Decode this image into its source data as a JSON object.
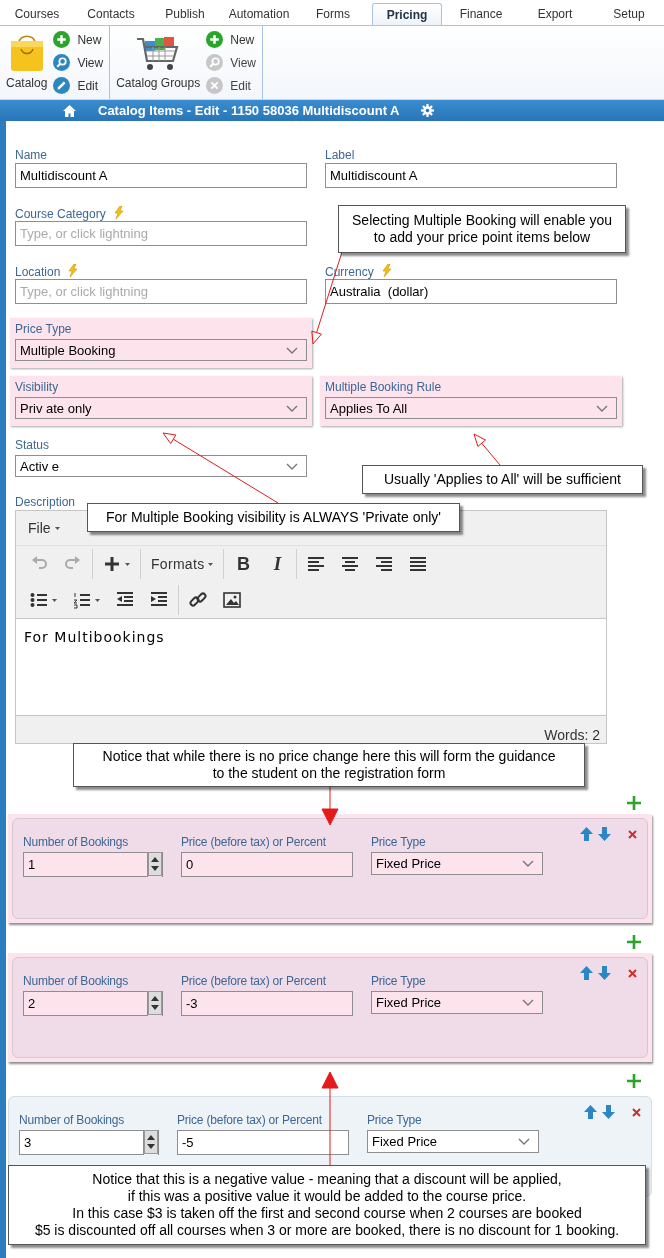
{
  "tabs": [
    {
      "label": "Courses",
      "selected": false
    },
    {
      "label": "Contacts",
      "selected": false
    },
    {
      "label": "Publish",
      "selected": false
    },
    {
      "label": "Automation",
      "selected": false
    },
    {
      "label": "Forms",
      "selected": false
    },
    {
      "label": "Pricing",
      "selected": true
    },
    {
      "label": "Finance",
      "selected": false
    },
    {
      "label": "Export",
      "selected": false
    },
    {
      "label": "Setup",
      "selected": false
    }
  ],
  "ribbon": {
    "groups": [
      {
        "kind": "bag",
        "label": "Catalog",
        "actions": [
          {
            "kind": "new",
            "label": "New",
            "disabled": false
          },
          {
            "kind": "view",
            "label": "View",
            "disabled": false
          },
          {
            "kind": "edit",
            "label": "Edit",
            "disabled": false
          }
        ]
      },
      {
        "kind": "cart",
        "label": "Catalog Groups",
        "actions": [
          {
            "kind": "new",
            "label": "New",
            "disabled": false
          },
          {
            "kind": "view",
            "label": "View",
            "disabled": true
          },
          {
            "kind": "edit",
            "label": "Edit",
            "disabled": true
          }
        ]
      }
    ]
  },
  "title_bar": {
    "title": "Catalog Items - Edit - 1150 58036 Multidiscount A"
  },
  "form": {
    "rows": [
      {
        "fields": [
          {
            "kind": "text",
            "label": "Name",
            "value": "Multidiscount A",
            "lightning": false,
            "highlighted": false
          },
          {
            "kind": "text",
            "label": "Label",
            "value": "Multidiscount A",
            "lightning": false,
            "highlighted": false
          }
        ]
      },
      {
        "fields": [
          {
            "kind": "text",
            "label": "Course Category",
            "placeholder": "Type, or click lightning",
            "lightning": true,
            "highlighted": false
          }
        ]
      },
      {
        "fields": [
          {
            "kind": "text",
            "label": "Location",
            "placeholder": "Type, or click lightning",
            "lightning": true,
            "highlighted": false
          },
          {
            "kind": "text",
            "label": "Currency",
            "value": "Australia  (dollar)",
            "lightning": true,
            "highlighted": false
          }
        ]
      },
      {
        "fields": [
          {
            "kind": "select",
            "label": "Price Type",
            "value": "Multiple Booking",
            "lightning": false,
            "highlighted": true
          }
        ]
      },
      {
        "fields": [
          {
            "kind": "select",
            "label": "Visibility",
            "value": "Priv ate only",
            "lightning": false,
            "highlighted": true
          },
          {
            "kind": "select",
            "label": "Multiple Booking Rule",
            "value": "Applies To All",
            "lightning": false,
            "highlighted": true
          }
        ]
      },
      {
        "fields": [
          {
            "kind": "select",
            "label": "Status",
            "value": "Activ e",
            "lightning": false,
            "highlighted": false
          }
        ]
      }
    ]
  },
  "description": {
    "label": "Description",
    "menu": [
      "File"
    ],
    "toolbar": [
      [
        [
          {
            "kind": "undo",
            "disabled": true
          },
          {
            "kind": "redo",
            "disabled": true
          }
        ],
        [
          {
            "kind": "insert",
            "has_menu": true
          }
        ],
        [
          {
            "kind": "formats",
            "label": "Formats",
            "has_menu": true
          }
        ],
        [
          {
            "kind": "bold",
            "label": "B"
          },
          {
            "kind": "italic",
            "label": "I"
          }
        ],
        [
          {
            "kind": "align-left"
          },
          {
            "kind": "align-center"
          },
          {
            "kind": "align-right"
          },
          {
            "kind": "justify"
          }
        ]
      ],
      [
        [
          {
            "kind": "bullet-list",
            "has_menu": true
          },
          {
            "kind": "numbered-list",
            "has_menu": true
          },
          {
            "kind": "outdent"
          },
          {
            "kind": "indent"
          }
        ],
        [
          {
            "kind": "link"
          },
          {
            "kind": "image"
          }
        ]
      ]
    ],
    "content": "For Multibookings",
    "word_count": "Words: 2"
  },
  "price_points": [
    {
      "highlighted": true,
      "fields": [
        {
          "kind": "spinner",
          "label": "Number of Bookings",
          "value": "1"
        },
        {
          "kind": "text",
          "label": "Price (before tax) or Percent",
          "value": "0"
        },
        {
          "kind": "select",
          "label": "Price Type",
          "value": "Fixed Price"
        }
      ]
    },
    {
      "highlighted": true,
      "fields": [
        {
          "kind": "spinner",
          "label": "Number of Bookings",
          "value": "2"
        },
        {
          "kind": "text",
          "label": "Price (before tax) or Percent",
          "value": "-3"
        },
        {
          "kind": "select",
          "label": "Price Type",
          "value": "Fixed Price"
        }
      ]
    },
    {
      "highlighted": false,
      "fields": [
        {
          "kind": "spinner",
          "label": "Number of Bookings",
          "value": "3"
        },
        {
          "kind": "text",
          "label": "Price (before tax) or Percent",
          "value": "-5"
        },
        {
          "kind": "select",
          "label": "Price Type",
          "value": "Fixed Price"
        }
      ]
    }
  ],
  "callouts": [
    {
      "lines": [
        "Selecting Multiple Booking will enable you",
        "to add your price point items below"
      ]
    },
    {
      "lines": [
        "Usually 'Applies to All' will be sufficient"
      ]
    },
    {
      "lines": [
        "For Multiple Booking visibility is ALWAYS 'Private only'"
      ]
    },
    {
      "lines": [
        "Notice that while there is no price change here this will form the guidance",
        "to the student on the registration form"
      ]
    },
    {
      "lines": [
        "Notice that this is a negative value - meaning that a discount will be applied,",
        "if this was a positive value it would be added to the course price.",
        "In this case $3 is taken off the first and second course when 2 courses are booked",
        "$5 is discounted off all courses when 3 or more are booked, there is no discount for 1 booking."
      ]
    }
  ]
}
